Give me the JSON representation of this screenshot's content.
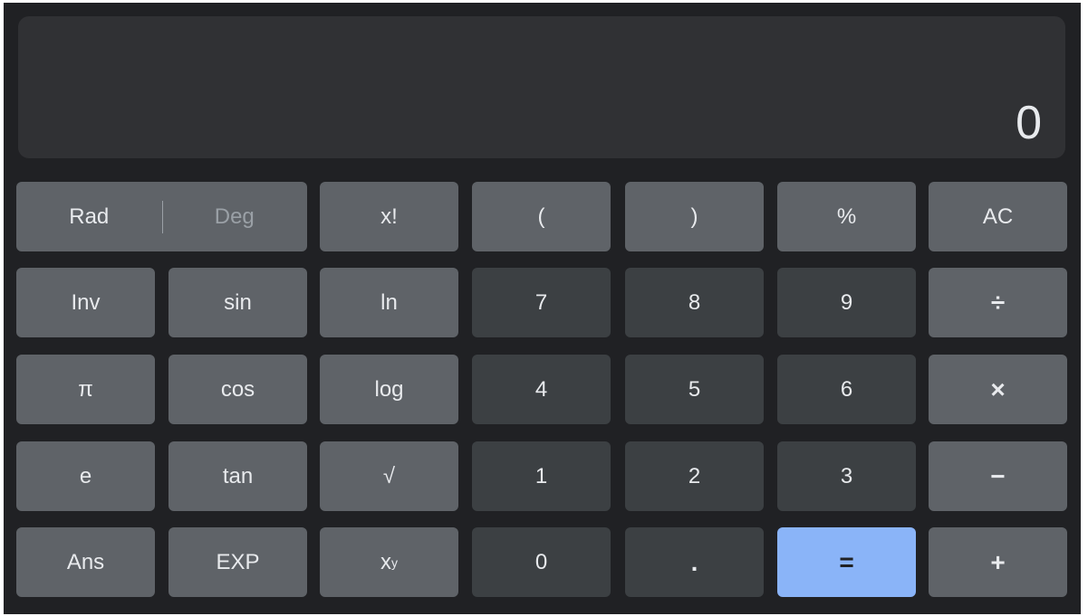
{
  "display": {
    "value": "0"
  },
  "keys": {
    "rad": "Rad",
    "deg": "Deg",
    "factorial": "x!",
    "open_paren": "(",
    "close_paren": ")",
    "percent": "%",
    "clear": "AC",
    "inv": "Inv",
    "sin": "sin",
    "ln": "ln",
    "seven": "7",
    "eight": "8",
    "nine": "9",
    "divide": "÷",
    "pi": "π",
    "cos": "cos",
    "log": "log",
    "four": "4",
    "five": "5",
    "six": "6",
    "multiply": "×",
    "e": "e",
    "tan": "tan",
    "sqrt": "√",
    "one": "1",
    "two": "2",
    "three": "3",
    "minus": "−",
    "ans": "Ans",
    "exp": "EXP",
    "power_base": "x",
    "power_exp": "y",
    "zero": "0",
    "decimal": ".",
    "equals": "=",
    "plus": "+"
  },
  "colors": {
    "background": "#202124",
    "display": "#303134",
    "function_key": "#5f6368",
    "number_key": "#3c4043",
    "equals_key": "#8ab4f8",
    "text": "#e8eaed",
    "muted_text": "#9aa0a6"
  }
}
